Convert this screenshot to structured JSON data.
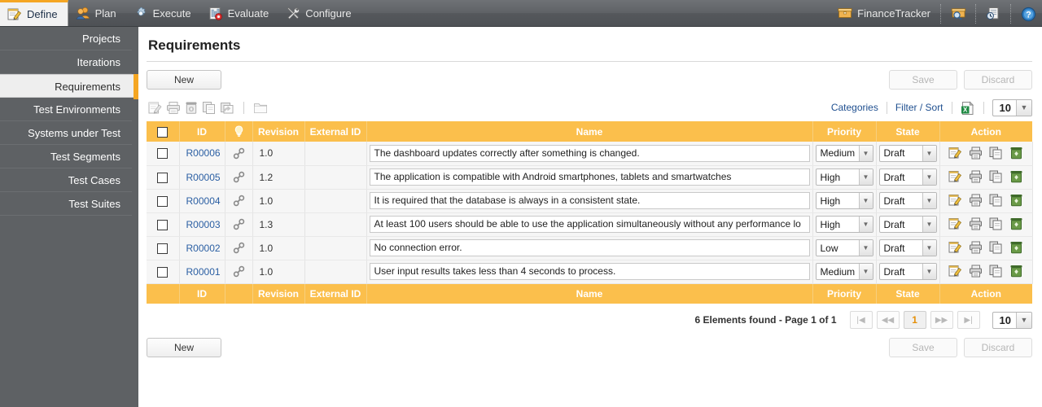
{
  "topnav": {
    "tabs": [
      {
        "label": "Define",
        "icon": "notepad-pencil-icon",
        "active": true
      },
      {
        "label": "Plan",
        "icon": "users-icon",
        "active": false
      },
      {
        "label": "Execute",
        "icon": "gear-icon",
        "active": false
      },
      {
        "label": "Evaluate",
        "icon": "chart-report-icon",
        "active": false
      },
      {
        "label": "Configure",
        "icon": "tools-icon",
        "active": false
      }
    ],
    "project": {
      "label": "FinanceTracker",
      "icon": "project-box-icon"
    },
    "actions": [
      {
        "name": "search-project-icon",
        "icon": "box-magnifier-icon"
      },
      {
        "name": "recent-reports-icon",
        "icon": "document-clock-icon"
      },
      {
        "name": "help-icon",
        "icon": "question-circle-icon"
      }
    ]
  },
  "sidebar": {
    "items": [
      {
        "label": "Projects",
        "active": false
      },
      {
        "label": "Iterations",
        "active": false
      },
      {
        "label": "Requirements",
        "active": true
      },
      {
        "label": "Test Environments",
        "active": false
      },
      {
        "label": "Systems under Test",
        "active": false
      },
      {
        "label": "Test Segments",
        "active": false
      },
      {
        "label": "Test Cases",
        "active": false
      },
      {
        "label": "Test Suites",
        "active": false
      }
    ]
  },
  "page": {
    "title": "Requirements",
    "new_label": "New",
    "save_label": "Save",
    "discard_label": "Discard",
    "new_label_bottom": "New",
    "save_label_bottom": "Save",
    "discard_label_bottom": "Discard"
  },
  "toolbar": {
    "icons": [
      {
        "name": "edit-icon",
        "enabled": false
      },
      {
        "name": "print-icon",
        "enabled": false
      },
      {
        "name": "delete-icon",
        "enabled": false
      },
      {
        "name": "copy-icon",
        "enabled": false
      },
      {
        "name": "duplicate-icon",
        "enabled": false
      },
      {
        "name": "folder-icon",
        "enabled": false
      }
    ],
    "categories_label": "Categories",
    "filter_sort_label": "Filter / Sort",
    "export_icon": "excel-export-icon",
    "page_size": "10"
  },
  "table": {
    "columns": [
      "ID",
      "Revision",
      "External ID",
      "Name",
      "Priority",
      "State",
      "Action"
    ],
    "select_all_checked": false,
    "link_column_icon": "lightbulb-icon",
    "row_link_icon": "chain-link-icon",
    "action_icons": [
      "edit-icon",
      "print-icon",
      "copy-icon",
      "delete-icon"
    ],
    "rows": [
      {
        "checked": false,
        "id": "R00006",
        "revision": "1.0",
        "external_id": "",
        "name": "The dashboard updates correctly after something is changed.",
        "priority": "Medium",
        "state": "Draft"
      },
      {
        "checked": false,
        "id": "R00005",
        "revision": "1.2",
        "external_id": "",
        "name": "The application is compatible with Android smartphones, tablets and smartwatches",
        "priority": "High",
        "state": "Draft"
      },
      {
        "checked": false,
        "id": "R00004",
        "revision": "1.0",
        "external_id": "",
        "name": "It is required that the database is always in a consistent state.",
        "priority": "High",
        "state": "Draft"
      },
      {
        "checked": false,
        "id": "R00003",
        "revision": "1.3",
        "external_id": "",
        "name": "At least 100 users should be able to use the application simultaneously without any performance lo",
        "priority": "High",
        "state": "Draft"
      },
      {
        "checked": false,
        "id": "R00002",
        "revision": "1.0",
        "external_id": "",
        "name": "No connection error.",
        "priority": "Low",
        "state": "Draft"
      },
      {
        "checked": false,
        "id": "R00001",
        "revision": "1.0",
        "external_id": "",
        "name": "User input results takes less than 4 seconds to process.",
        "priority": "Medium",
        "state": "Draft"
      }
    ]
  },
  "pagination": {
    "summary": "6 Elements found - Page 1 of 1",
    "first_label": "|◀",
    "prev_label": "◀◀",
    "current_page": "1",
    "next_label": "▶▶",
    "last_label": "▶|",
    "page_size": "10"
  },
  "colors": {
    "accent_orange": "#fbbf4c",
    "topbar_gray": "#5f6266",
    "sidebar_gray": "#5e6164",
    "link_blue": "#2b5fa3"
  }
}
